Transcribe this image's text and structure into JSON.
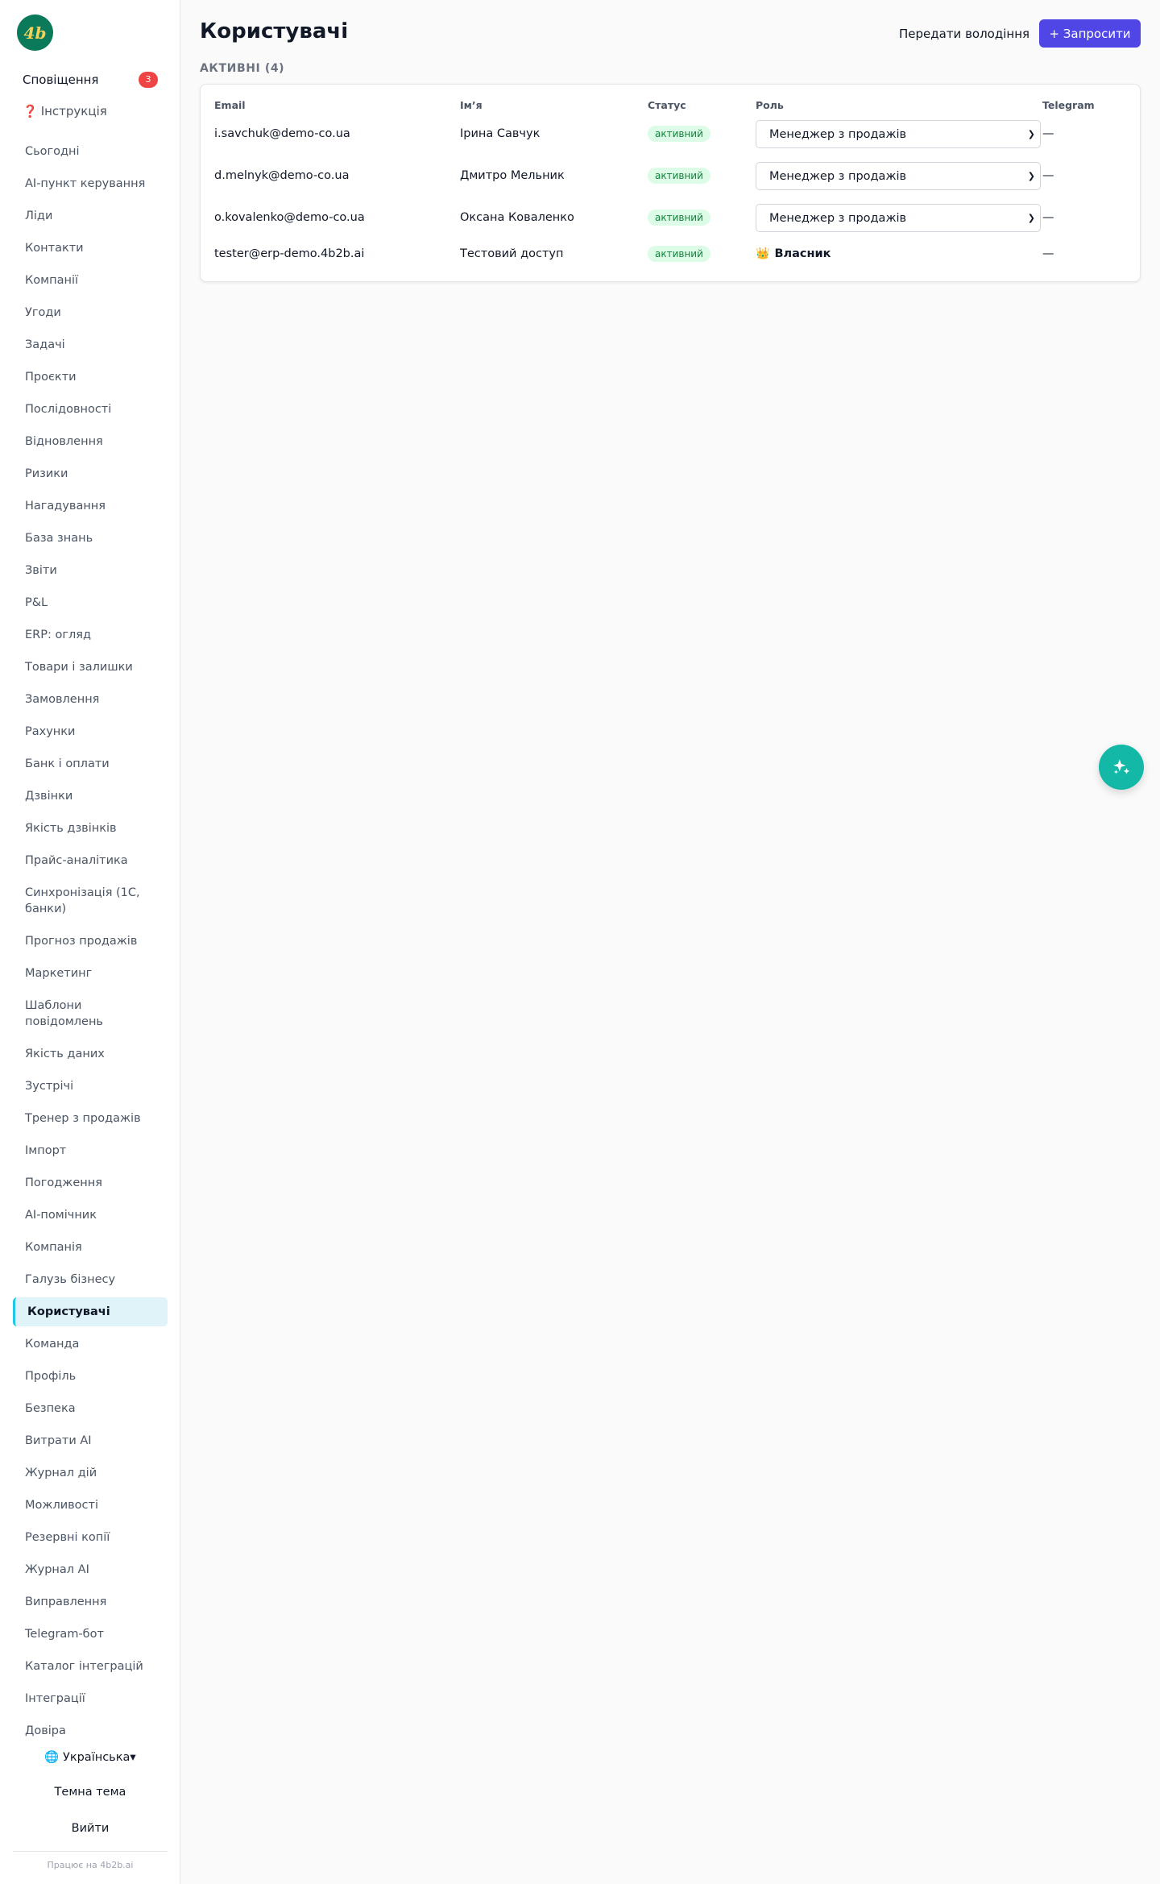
{
  "sidebar": {
    "logo_text": "4b",
    "notifications_label": "Сповіщення",
    "notifications_count": "3",
    "help_icon": "❓",
    "help_label": "Інструкція",
    "items": [
      {
        "label": "Сьогодні"
      },
      {
        "label": "AI-пункт керування"
      },
      {
        "label": "Ліди"
      },
      {
        "label": "Контакти"
      },
      {
        "label": "Компанії"
      },
      {
        "label": "Угоди"
      },
      {
        "label": "Задачі"
      },
      {
        "label": "Проєкти"
      },
      {
        "label": "Послідовності"
      },
      {
        "label": "Відновлення"
      },
      {
        "label": "Ризики"
      },
      {
        "label": "Нагадування"
      },
      {
        "label": "База знань"
      },
      {
        "label": "Звіти"
      },
      {
        "label": "P&L"
      },
      {
        "label": "ERP: огляд"
      },
      {
        "label": "Товари і залишки"
      },
      {
        "label": "Замовлення"
      },
      {
        "label": "Рахунки"
      },
      {
        "label": "Банк і оплати"
      },
      {
        "label": "Дзвінки"
      },
      {
        "label": "Якість дзвінків"
      },
      {
        "label": "Прайс-аналітика"
      },
      {
        "label": "Синхронізація (1С, банки)"
      },
      {
        "label": "Прогноз продажів"
      },
      {
        "label": "Маркетинг"
      },
      {
        "label": "Шаблони повідомлень"
      },
      {
        "label": "Якість даних"
      },
      {
        "label": "Зустрічі"
      },
      {
        "label": "Тренер з продажів"
      },
      {
        "label": "Імпорт"
      },
      {
        "label": "Погодження"
      },
      {
        "label": "AI-помічник"
      },
      {
        "label": "Компанія"
      },
      {
        "label": "Галузь бізнесу"
      },
      {
        "label": "Користувачі",
        "active": true
      },
      {
        "label": "Команда"
      },
      {
        "label": "Профіль"
      },
      {
        "label": "Безпека"
      },
      {
        "label": "Витрати AI"
      },
      {
        "label": "Журнал дій"
      },
      {
        "label": "Можливості"
      },
      {
        "label": "Резервні копії"
      },
      {
        "label": "Журнал AI"
      },
      {
        "label": "Виправлення"
      },
      {
        "label": "Telegram-бот"
      },
      {
        "label": "Каталог інтеграцій"
      },
      {
        "label": "Інтеграції"
      },
      {
        "label": "Довіра"
      }
    ],
    "language_label": "🌐 Українська▾",
    "theme_label": "Темна тема",
    "logout_label": "Вийти",
    "powered_by": "Працює на 4b2b.ai"
  },
  "header": {
    "title": "Користувачі",
    "transfer_label": "Передати володіння",
    "invite_label": "+ Запросити"
  },
  "section": {
    "title": "АКТИВНІ (4)"
  },
  "table": {
    "columns": {
      "email": "Email",
      "name": "Ім’я",
      "status": "Статус",
      "role": "Роль",
      "telegram": "Telegram"
    },
    "rows": [
      {
        "email": "i.savchuk@demo-co.ua",
        "name": "Ірина Савчук",
        "status": "активний",
        "role": "Менеджер з продажів",
        "telegram": "—"
      },
      {
        "email": "d.melnyk@demo-co.ua",
        "name": "Дмитро Мельник",
        "status": "активний",
        "role": "Менеджер з продажів",
        "telegram": "—"
      },
      {
        "email": "o.kovalenko@demo-co.ua",
        "name": "Оксана Коваленко",
        "status": "активний",
        "role": "Менеджер з продажів",
        "telegram": "—"
      },
      {
        "email": "tester@erp-demo.4b2b.ai",
        "name": "Тестовий доступ",
        "status": "активний",
        "role": "Власник",
        "role_icon": "👑",
        "telegram": "—"
      }
    ]
  },
  "colors": {
    "accent": "#4f46e5",
    "active_nav_bg": "#dff3f9",
    "active_nav_border": "#22c7e8",
    "status_bg": "#dcfce7",
    "status_text": "#15803d",
    "fab": "#14b8a6",
    "badge": "#ef4444",
    "logo_bg": "#0b7a5a"
  }
}
